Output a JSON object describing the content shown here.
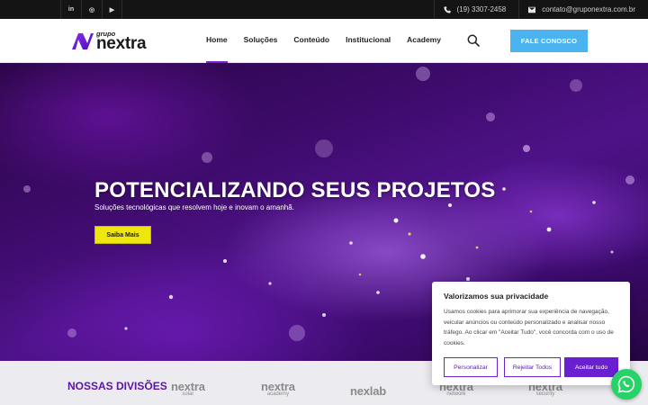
{
  "topbar": {
    "social": [
      {
        "label": "in",
        "icon": "linkedin-icon"
      },
      {
        "label": "◎",
        "icon": "instagram-icon"
      },
      {
        "label": "▶",
        "icon": "youtube-icon"
      }
    ],
    "phone": "(19) 3307-2458",
    "email": "contato@gruponextra.com.br"
  },
  "header": {
    "logo_small": "grupo",
    "logo_brand": "nextra",
    "nav": [
      "Home",
      "Soluções",
      "Conteúdo",
      "Institucional",
      "Academy"
    ],
    "active_nav": "Home",
    "cta": "FALE CONOSCO"
  },
  "hero": {
    "title": "POTENCIALIZANDO SEUS PROJETOS",
    "subtitle": "Soluções tecnológicas que resolvem hoje e inovam o amanhã.",
    "button": "Saiba Mais"
  },
  "divisions": {
    "title": "NOSSAS DIVISÕES",
    "logos": [
      {
        "name": "nextra",
        "sub": "solar"
      },
      {
        "name": "nextra",
        "sub": "academy"
      },
      {
        "name": "nexlab",
        "sub": ""
      },
      {
        "name": "nextra",
        "sub": "network"
      },
      {
        "name": "nextra",
        "sub": "security"
      }
    ]
  },
  "cookie": {
    "title": "Valorizamos sua privacidade",
    "body": "Usamos cookies para aprimorar sua experiência de navegação, veicular anúncios ou conteúdo personalizado e analisar nosso tráfego. Ao clicar em \"Aceitar Tudo\", você concorda com o uso de cookies.",
    "customize": "Personalizar",
    "reject": "Rejeitar Todos",
    "accept": "Aceitar tudo"
  },
  "colors": {
    "brand_purple": "#6a1fd1",
    "cta_blue": "#4ab3f0",
    "hero_button": "#f0e60f",
    "whatsapp": "#25d366"
  }
}
